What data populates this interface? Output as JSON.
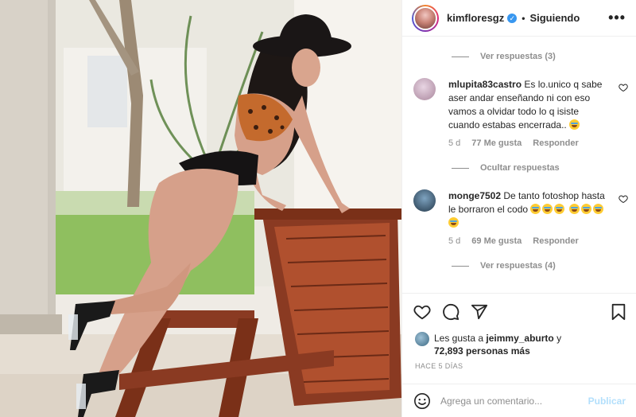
{
  "post": {
    "username": "kimfloresgz",
    "separator": "•",
    "follow_state": "Siguiendo",
    "more_icon": "more-horizontal-icon",
    "verified_icon": "verified-badge-icon"
  },
  "comments": {
    "view_replies_top": "Ver respuestas (3)",
    "items": [
      {
        "username": "mlupita83castro",
        "text": "Es lo.unico q sabe aser andar enseñando ni con eso vamos a olvidar todo lo q isiste cuando estabas encerrada..",
        "emoji": "😂",
        "age": "5 d",
        "likes": "77 Me gusta",
        "reply": "Responder",
        "replies_toggle": "Ocultar respuestas"
      },
      {
        "username": "monge7502",
        "text": "De tanto fotoshop hasta le borraron el codo",
        "emoji": "😂😂😂😂😂😂",
        "age": "5 d",
        "likes": "69 Me gusta",
        "reply": "Responder",
        "replies_toggle": "Ver respuestas (4)"
      }
    ]
  },
  "actions": {
    "like_icon": "heart-icon",
    "comment_icon": "comment-icon",
    "share_icon": "share-icon",
    "save_icon": "bookmark-icon"
  },
  "likes": {
    "prefix": "Les gusta a",
    "user": "jeimmy_aburto",
    "connector": "y",
    "count": "72,893 personas más"
  },
  "timestamp": "HACE 5 DÍAS",
  "add_comment": {
    "placeholder": "Agrega un comentario...",
    "publish": "Publicar",
    "emoji_icon": "smile-icon"
  },
  "colors": {
    "accent_blue": "#3897f0",
    "publish_disabled": "#b2dffc",
    "muted_text": "#8e8e8e"
  }
}
